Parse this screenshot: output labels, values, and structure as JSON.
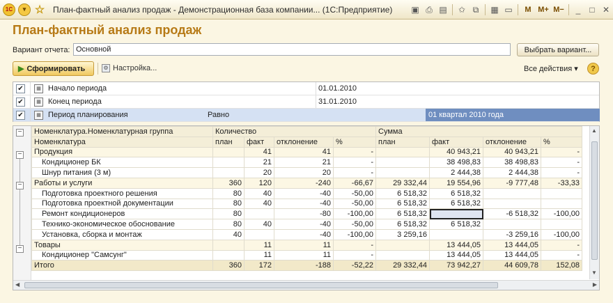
{
  "window": {
    "title": "План-фактный анализ продаж - Демонстрационная база компании...  (1С:Предприятие)",
    "toolbar_m": [
      "M",
      "M+",
      "M−"
    ]
  },
  "page": {
    "title": "План-фактный анализ продаж",
    "variant_label": "Вариант отчета:",
    "variant_value": "Основной",
    "choose_variant_button": "Выбрать вариант...",
    "form_button": "Сформировать",
    "settings_button": "Настройка...",
    "all_actions": "Все действия ▾",
    "help": "?"
  },
  "settings": [
    {
      "checked": true,
      "name": "Начало периода",
      "condition": "",
      "value": "01.01.2010"
    },
    {
      "checked": true,
      "name": "Конец периода",
      "condition": "",
      "value": "31.01.2010"
    },
    {
      "checked": true,
      "name": "Период планирования",
      "condition": "Равно",
      "value": "01 квартал 2010 года"
    }
  ],
  "report": {
    "header1": [
      "Номенклатура.Номенклатурная группа",
      "Количество",
      "Сумма"
    ],
    "header2": [
      "Номенклатура",
      "план",
      "факт",
      "отклонение",
      "%",
      "план",
      "факт",
      "отклонение",
      "%"
    ],
    "rows": [
      {
        "type": "group",
        "name": "Продукция",
        "cells": [
          "",
          "41",
          "41",
          "-",
          "",
          "40 943,21",
          "40 943,21",
          "-"
        ]
      },
      {
        "type": "item",
        "name": "Кондиционер БК",
        "cells": [
          "",
          "21",
          "21",
          "-",
          "",
          "38 498,83",
          "38 498,83",
          "-"
        ]
      },
      {
        "type": "item",
        "name": "Шнур питания (3 м)",
        "cells": [
          "",
          "20",
          "20",
          "-",
          "",
          "2 444,38",
          "2 444,38",
          "-"
        ]
      },
      {
        "type": "group",
        "name": "Работы и услуги",
        "cells": [
          "360",
          "120",
          "-240",
          "-66,67",
          "29 332,44",
          "19 554,96",
          "-9 777,48",
          "-33,33"
        ]
      },
      {
        "type": "item",
        "name": "Подготовка проектного решения",
        "cells": [
          "80",
          "40",
          "-40",
          "-50,00",
          "6 518,32",
          "6 518,32",
          "",
          ""
        ]
      },
      {
        "type": "item",
        "name": "Подготовка проектной документации",
        "cells": [
          "80",
          "40",
          "-40",
          "-50,00",
          "6 518,32",
          "6 518,32",
          "",
          ""
        ]
      },
      {
        "type": "item",
        "name": "Ремонт кондиционеров",
        "cells": [
          "80",
          "",
          "-80",
          "-100,00",
          "6 518,32",
          "",
          "-6 518,32",
          "-100,00"
        ]
      },
      {
        "type": "item",
        "name": "Технико-экономическое обоснование",
        "cells": [
          "80",
          "40",
          "-40",
          "-50,00",
          "6 518,32",
          "6 518,32",
          "",
          ""
        ]
      },
      {
        "type": "item",
        "name": "Установка, сборка и монтаж",
        "cells": [
          "40",
          "",
          "-40",
          "-100,00",
          "3 259,16",
          "",
          "-3 259,16",
          "-100,00"
        ]
      },
      {
        "type": "group",
        "name": "Товары",
        "cells": [
          "",
          "11",
          "11",
          "-",
          "",
          "13 444,05",
          "13 444,05",
          "-"
        ]
      },
      {
        "type": "item",
        "name": "Кондиционер \"Самсунг\"",
        "cells": [
          "",
          "11",
          "11",
          "-",
          "",
          "13 444,05",
          "13 444,05",
          "-"
        ]
      }
    ],
    "total": {
      "name": "Итого",
      "cells": [
        "360",
        "172",
        "-188",
        "-52,22",
        "29 332,44",
        "73 942,27",
        "44 609,78",
        "152,08"
      ]
    }
  }
}
